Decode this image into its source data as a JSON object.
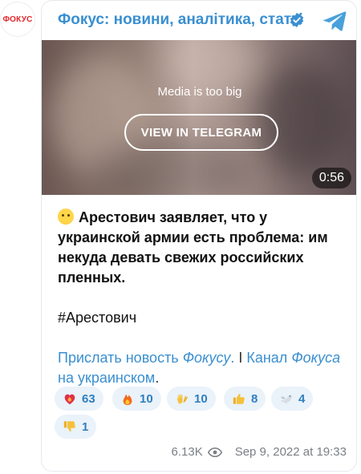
{
  "avatar": {
    "text": "ФОКУС",
    "color": "#e3262a"
  },
  "header": {
    "title": "Фокус: новини, аналітика, статті",
    "verified_icon": "verified-badge-icon",
    "telegram_icon": "telegram-plane-icon"
  },
  "media": {
    "note": "Media is too big",
    "button_label": "VIEW IN TELEGRAM",
    "duration": "0:56"
  },
  "post": {
    "lead_emoji": "surprised-face-emoji",
    "lead": "Арестович заявляет, что у украинской армии есть проблема: им некуда девать свежих российских пленных.",
    "hashtag": "#Арестович",
    "link_1a": "Прислать новость ",
    "link_1b": "Фокусу",
    "link_1c": ".",
    "separator": " I ",
    "link_2a": "Канал ",
    "link_2b": "Фокуса",
    "link_2c": " на украинском",
    "link_end": "."
  },
  "reactions": [
    {
      "emoji": "heart-on-fire",
      "count": "63"
    },
    {
      "emoji": "fire",
      "count": "10"
    },
    {
      "emoji": "clapping-hands",
      "count": "10"
    },
    {
      "emoji": "thumbs-up",
      "count": "8"
    },
    {
      "emoji": "dove",
      "count": "4"
    },
    {
      "emoji": "thumbs-down",
      "count": "1"
    }
  ],
  "meta": {
    "views": "6.13K",
    "date": "Sep 9, 2022 at 19:33"
  },
  "colors": {
    "accent": "#3a8fd0",
    "reaction_bg": "#eaf2fa",
    "muted": "#7b7f84"
  }
}
